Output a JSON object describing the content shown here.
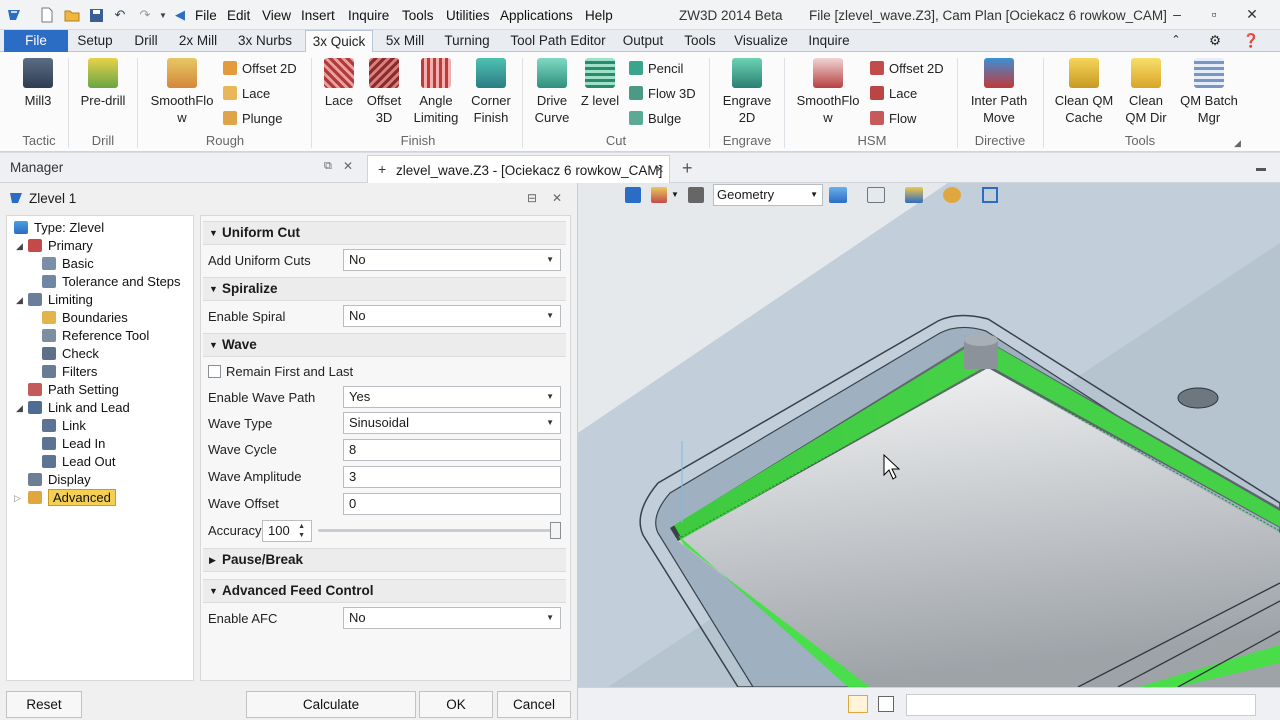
{
  "app_title": "ZW3D 2014 Beta",
  "file_title": "File [zlevel_wave.Z3],  Cam Plan [Ociekacz 6 rowkow_CAM]",
  "menu": [
    "File",
    "Edit",
    "View",
    "Insert",
    "Inquire",
    "Tools",
    "Utilities",
    "Applications",
    "Help"
  ],
  "ribbon_tabs": [
    "File",
    "Setup",
    "Drill",
    "2x Mill",
    "3x Nurbs",
    "3x Quick",
    "5x Mill",
    "Turning",
    "Tool Path Editor",
    "Output",
    "Tools",
    "Visualize",
    "Inquire"
  ],
  "ribbon": {
    "mill3": "Mill3",
    "predrill": "Pre-drill",
    "smoothflow": "SmoothFlo w",
    "offset2d": "Offset 2D",
    "lace": "Lace",
    "plunge": "Plunge",
    "lace_big": "Lace",
    "offset3d": "Offset 3D",
    "angle_limiting": "Angle Limiting",
    "corner_finish": "Corner Finish",
    "drive_curve": "Drive Curve",
    "z_level": "Z level",
    "pencil": "Pencil",
    "flow3d": "Flow 3D",
    "bulge": "Bulge",
    "engrave2d": "Engrave 2D",
    "hsm_smoothflow": "SmoothFlo w",
    "hsm_offset2d": "Offset 2D",
    "hsm_lace": "Lace",
    "hsm_flow": "Flow",
    "inter_path_move": "Inter Path Move",
    "clean_qm_cache": "Clean QM Cache",
    "clean_qm_dir": "Clean QM Dir",
    "qm_batch_mgr": "QM Batch Mgr",
    "groups": {
      "tactic": "Tactic",
      "drill": "Drill",
      "rough": "Rough",
      "finish": "Finish",
      "cut": "Cut",
      "engrave": "Engrave",
      "hsm": "HSM",
      "directive": "Directive",
      "tools": "Tools"
    }
  },
  "manager_label": "Manager",
  "doc_tab": "zlevel_wave.Z3 - [Ociekacz 6 rowkow_CAM]",
  "dialog_title": "Zlevel 1",
  "tree": [
    {
      "label": "Type: Zlevel"
    },
    {
      "label": "Primary"
    },
    {
      "label": "Basic"
    },
    {
      "label": "Tolerance and Steps"
    },
    {
      "label": "Limiting"
    },
    {
      "label": "Boundaries"
    },
    {
      "label": "Reference Tool"
    },
    {
      "label": "Check"
    },
    {
      "label": "Filters"
    },
    {
      "label": "Path Setting"
    },
    {
      "label": "Link and Lead"
    },
    {
      "label": "Link"
    },
    {
      "label": "Lead In"
    },
    {
      "label": "Lead Out"
    },
    {
      "label": "Display"
    },
    {
      "label": "Advanced"
    }
  ],
  "sections": {
    "uniform_cut": "Uniform Cut",
    "spiralize": "Spiralize",
    "wave": "Wave",
    "pause_break": "Pause/Break",
    "advanced_feed": "Advanced Feed Control"
  },
  "props": {
    "add_uniform_cuts": {
      "label": "Add Uniform Cuts",
      "value": "No"
    },
    "enable_spiral": {
      "label": "Enable Spiral",
      "value": "No"
    },
    "remain_first_last": {
      "label": "Remain First and Last",
      "checked": false
    },
    "enable_wave_path": {
      "label": "Enable Wave Path",
      "value": "Yes"
    },
    "wave_type": {
      "label": "Wave Type",
      "value": "Sinusoidal"
    },
    "wave_cycle": {
      "label": "Wave Cycle",
      "value": "8"
    },
    "wave_amplitude": {
      "label": "Wave Amplitude",
      "value": "3"
    },
    "wave_offset": {
      "label": "Wave Offset",
      "value": "0"
    },
    "accuracy": {
      "label": "Accuracy",
      "value": "100"
    },
    "enable_afc": {
      "label": "Enable AFC",
      "value": "No"
    }
  },
  "buttons": {
    "reset": "Reset",
    "calculate": "Calculate",
    "ok": "OK",
    "cancel": "Cancel"
  },
  "viewport": {
    "display_filter": "Geometry"
  },
  "colors": {
    "accent": "#2b6cc4",
    "toolpath": "#3fe33f",
    "part": "#b5c3cf"
  }
}
